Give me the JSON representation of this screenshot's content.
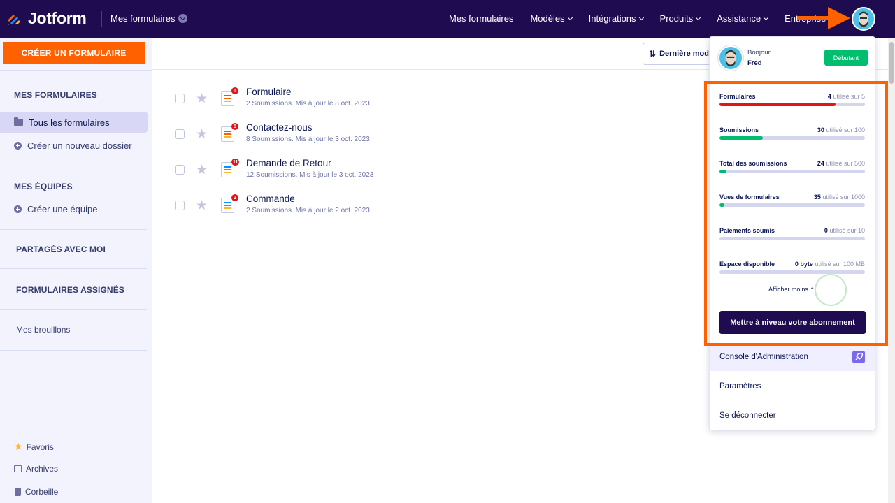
{
  "topbar": {
    "brand": "Jotform",
    "breadcrumb": "Mes formulaires",
    "nav": [
      "Mes formulaires",
      "Modèles",
      "Intégrations",
      "Produits",
      "Assistance",
      "Entreprise"
    ]
  },
  "sidebar": {
    "create_label": "CRÉER UN FORMULAIRE",
    "section_forms": "MES FORMULAIRES",
    "all_forms": "Tous les formulaires",
    "new_folder": "Créer un nouveau dossier",
    "section_teams": "MES ÉQUIPES",
    "create_team": "Créer une équipe",
    "shared": "PARTAGÉS AVEC MOI",
    "assigned": "FORMULAIRES ASSIGNÉS",
    "drafts": "Mes brouillons",
    "favorites": "Favoris",
    "archives": "Archives",
    "trash": "Corbeille"
  },
  "toolbar": {
    "sort_label": "Dernière mod"
  },
  "forms": [
    {
      "title": "Formulaire",
      "meta": "2 Soumissions. Mis à jour le 8 oct. 2023",
      "badge": "1"
    },
    {
      "title": "Contactez-nous",
      "meta": "8 Soumissions. Mis à jour le 3 oct. 2023",
      "badge": "8"
    },
    {
      "title": "Demande de Retour",
      "meta": "12 Soumissions. Mis à jour le 3 oct. 2023",
      "badge": "11"
    },
    {
      "title": "Commande",
      "meta": "2 Soumissions. Mis à jour le 2 oct. 2023",
      "badge": "2"
    }
  ],
  "account": {
    "greeting": "Bonjour,",
    "name": "Fred",
    "plan": "Débutant",
    "usage_suffix": "utilisé sur",
    "usage": [
      {
        "label": "Formulaires",
        "used": "4",
        "limit": "5",
        "fraction": 0.8,
        "color": "#e3151a"
      },
      {
        "label": "Soumissions",
        "used": "30",
        "limit": "100",
        "fraction": 0.3,
        "color": "#01bd6f"
      },
      {
        "label": "Total des soumissions",
        "used": "24",
        "limit": "500",
        "fraction": 0.048,
        "color": "#01bd6f"
      },
      {
        "label": "Vues de formulaires",
        "used": "35",
        "limit": "1000",
        "fraction": 0.035,
        "color": "#01bd6f"
      },
      {
        "label": "Paiements soumis",
        "used": "0",
        "limit": "10",
        "fraction": 0,
        "color": "#01bd6f"
      },
      {
        "label": "Espace disponible",
        "used": "0 byte",
        "limit": "100 MB",
        "fraction": 0,
        "color": "#01bd6f"
      }
    ],
    "show_less": "Afficher moins",
    "upgrade": "Mettre à niveau votre abonnement",
    "admin_console": "Console d'Administration",
    "settings": "Paramètres",
    "logout": "Se déconnecter"
  },
  "colors": {
    "accent": "#ff6100",
    "navy": "#1f0b4f",
    "green": "#01bd6f",
    "red": "#e3151a"
  }
}
